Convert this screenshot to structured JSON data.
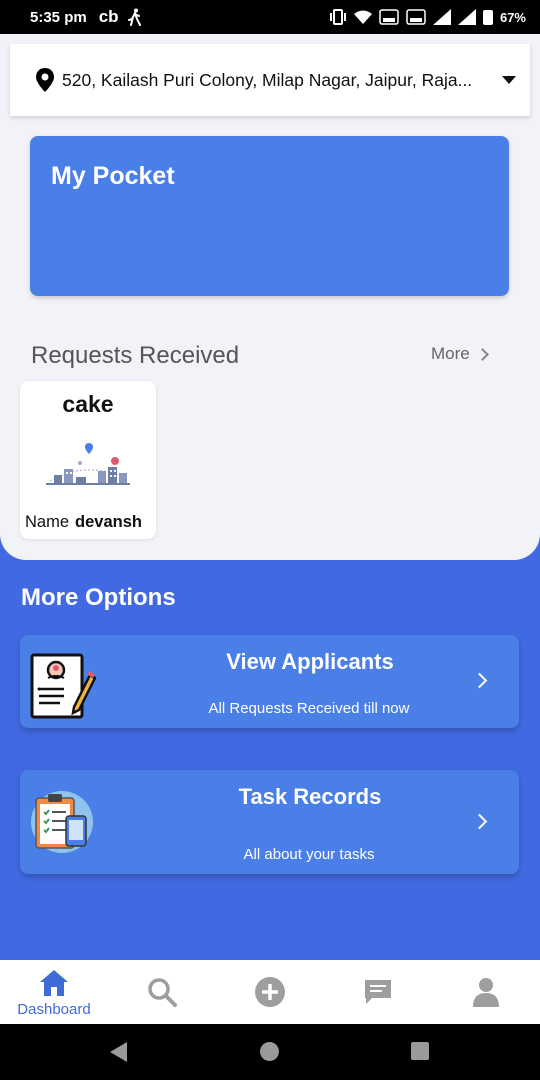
{
  "status_bar": {
    "time": "5:35 pm",
    "app_indicator": "cb",
    "battery": "67%",
    "icons": [
      "walk-icon",
      "vibrate-icon",
      "wifi-icon",
      "volte-icon",
      "signal-icon",
      "battery-icon"
    ]
  },
  "address": {
    "text": "520, Kailash Puri Colony, Milap Nagar, Jaipur, Raja..."
  },
  "pocket": {
    "title": "My Pocket"
  },
  "requests": {
    "title": "Requests Received",
    "more_label": "More",
    "items": [
      {
        "title": "cake",
        "name_label": "Name",
        "name_value": "devansh"
      }
    ]
  },
  "options": {
    "title": "More Options",
    "items": [
      {
        "title": "View Applicants",
        "subtitle": "All Requests Received till now"
      },
      {
        "title": "Task Records",
        "subtitle": "All about your tasks"
      }
    ]
  },
  "bottom_nav": {
    "items": [
      {
        "label": "Dashboard",
        "icon": "home-icon",
        "active": true
      },
      {
        "label": "",
        "icon": "search-icon"
      },
      {
        "label": "",
        "icon": "add-circle-icon"
      },
      {
        "label": "",
        "icon": "chat-icon"
      },
      {
        "label": "",
        "icon": "profile-icon"
      }
    ]
  },
  "colors": {
    "primary": "#4169E1",
    "card": "#4A7FE7",
    "nav_active": "#3F6BD6",
    "nav_inactive": "#9E9E9E",
    "sheet_bg": "#F1F3F8"
  }
}
